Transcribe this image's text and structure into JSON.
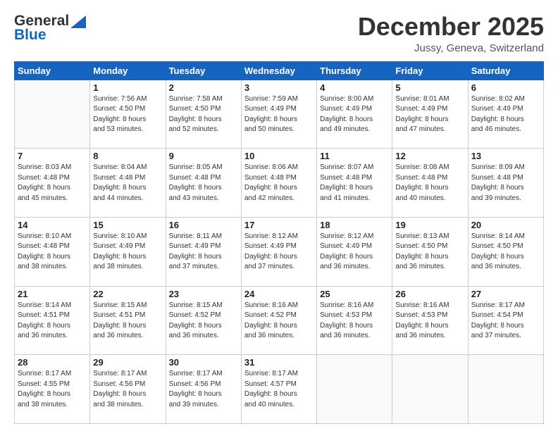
{
  "header": {
    "logo_line1": "General",
    "logo_line2": "Blue",
    "main_title": "December 2025",
    "subtitle": "Jussy, Geneva, Switzerland"
  },
  "days_of_week": [
    "Sunday",
    "Monday",
    "Tuesday",
    "Wednesday",
    "Thursday",
    "Friday",
    "Saturday"
  ],
  "weeks": [
    [
      {
        "day": "",
        "content": ""
      },
      {
        "day": "1",
        "content": "Sunrise: 7:56 AM\nSunset: 4:50 PM\nDaylight: 8 hours\nand 53 minutes."
      },
      {
        "day": "2",
        "content": "Sunrise: 7:58 AM\nSunset: 4:50 PM\nDaylight: 8 hours\nand 52 minutes."
      },
      {
        "day": "3",
        "content": "Sunrise: 7:59 AM\nSunset: 4:49 PM\nDaylight: 8 hours\nand 50 minutes."
      },
      {
        "day": "4",
        "content": "Sunrise: 8:00 AM\nSunset: 4:49 PM\nDaylight: 8 hours\nand 49 minutes."
      },
      {
        "day": "5",
        "content": "Sunrise: 8:01 AM\nSunset: 4:49 PM\nDaylight: 8 hours\nand 47 minutes."
      },
      {
        "day": "6",
        "content": "Sunrise: 8:02 AM\nSunset: 4:49 PM\nDaylight: 8 hours\nand 46 minutes."
      }
    ],
    [
      {
        "day": "7",
        "content": "Sunrise: 8:03 AM\nSunset: 4:48 PM\nDaylight: 8 hours\nand 45 minutes."
      },
      {
        "day": "8",
        "content": "Sunrise: 8:04 AM\nSunset: 4:48 PM\nDaylight: 8 hours\nand 44 minutes."
      },
      {
        "day": "9",
        "content": "Sunrise: 8:05 AM\nSunset: 4:48 PM\nDaylight: 8 hours\nand 43 minutes."
      },
      {
        "day": "10",
        "content": "Sunrise: 8:06 AM\nSunset: 4:48 PM\nDaylight: 8 hours\nand 42 minutes."
      },
      {
        "day": "11",
        "content": "Sunrise: 8:07 AM\nSunset: 4:48 PM\nDaylight: 8 hours\nand 41 minutes."
      },
      {
        "day": "12",
        "content": "Sunrise: 8:08 AM\nSunset: 4:48 PM\nDaylight: 8 hours\nand 40 minutes."
      },
      {
        "day": "13",
        "content": "Sunrise: 8:09 AM\nSunset: 4:48 PM\nDaylight: 8 hours\nand 39 minutes."
      }
    ],
    [
      {
        "day": "14",
        "content": "Sunrise: 8:10 AM\nSunset: 4:48 PM\nDaylight: 8 hours\nand 38 minutes."
      },
      {
        "day": "15",
        "content": "Sunrise: 8:10 AM\nSunset: 4:49 PM\nDaylight: 8 hours\nand 38 minutes."
      },
      {
        "day": "16",
        "content": "Sunrise: 8:11 AM\nSunset: 4:49 PM\nDaylight: 8 hours\nand 37 minutes."
      },
      {
        "day": "17",
        "content": "Sunrise: 8:12 AM\nSunset: 4:49 PM\nDaylight: 8 hours\nand 37 minutes."
      },
      {
        "day": "18",
        "content": "Sunrise: 8:12 AM\nSunset: 4:49 PM\nDaylight: 8 hours\nand 36 minutes."
      },
      {
        "day": "19",
        "content": "Sunrise: 8:13 AM\nSunset: 4:50 PM\nDaylight: 8 hours\nand 36 minutes."
      },
      {
        "day": "20",
        "content": "Sunrise: 8:14 AM\nSunset: 4:50 PM\nDaylight: 8 hours\nand 36 minutes."
      }
    ],
    [
      {
        "day": "21",
        "content": "Sunrise: 8:14 AM\nSunset: 4:51 PM\nDaylight: 8 hours\nand 36 minutes."
      },
      {
        "day": "22",
        "content": "Sunrise: 8:15 AM\nSunset: 4:51 PM\nDaylight: 8 hours\nand 36 minutes."
      },
      {
        "day": "23",
        "content": "Sunrise: 8:15 AM\nSunset: 4:52 PM\nDaylight: 8 hours\nand 36 minutes."
      },
      {
        "day": "24",
        "content": "Sunrise: 8:16 AM\nSunset: 4:52 PM\nDaylight: 8 hours\nand 36 minutes."
      },
      {
        "day": "25",
        "content": "Sunrise: 8:16 AM\nSunset: 4:53 PM\nDaylight: 8 hours\nand 36 minutes."
      },
      {
        "day": "26",
        "content": "Sunrise: 8:16 AM\nSunset: 4:53 PM\nDaylight: 8 hours\nand 36 minutes."
      },
      {
        "day": "27",
        "content": "Sunrise: 8:17 AM\nSunset: 4:54 PM\nDaylight: 8 hours\nand 37 minutes."
      }
    ],
    [
      {
        "day": "28",
        "content": "Sunrise: 8:17 AM\nSunset: 4:55 PM\nDaylight: 8 hours\nand 38 minutes."
      },
      {
        "day": "29",
        "content": "Sunrise: 8:17 AM\nSunset: 4:56 PM\nDaylight: 8 hours\nand 38 minutes."
      },
      {
        "day": "30",
        "content": "Sunrise: 8:17 AM\nSunset: 4:56 PM\nDaylight: 8 hours\nand 39 minutes."
      },
      {
        "day": "31",
        "content": "Sunrise: 8:17 AM\nSunset: 4:57 PM\nDaylight: 8 hours\nand 40 minutes."
      },
      {
        "day": "",
        "content": ""
      },
      {
        "day": "",
        "content": ""
      },
      {
        "day": "",
        "content": ""
      }
    ]
  ]
}
